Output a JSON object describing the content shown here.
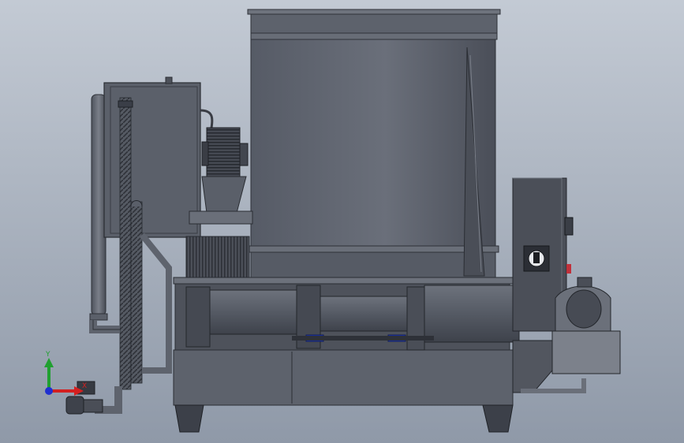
{
  "viewport": {
    "background_top": "#c3cad4",
    "background_bottom": "#8f99a8"
  },
  "model": {
    "body_color": "#5a5f6a",
    "dark_color": "#3c4049",
    "light_color": "#70757f",
    "accent_blue": "#1d3fd0",
    "accent_red": "#c0303a"
  },
  "triad": {
    "x_label": "X",
    "y_label": "Y",
    "x_color": "#d42020",
    "y_color": "#20a030",
    "z_color": "#2030d0"
  }
}
